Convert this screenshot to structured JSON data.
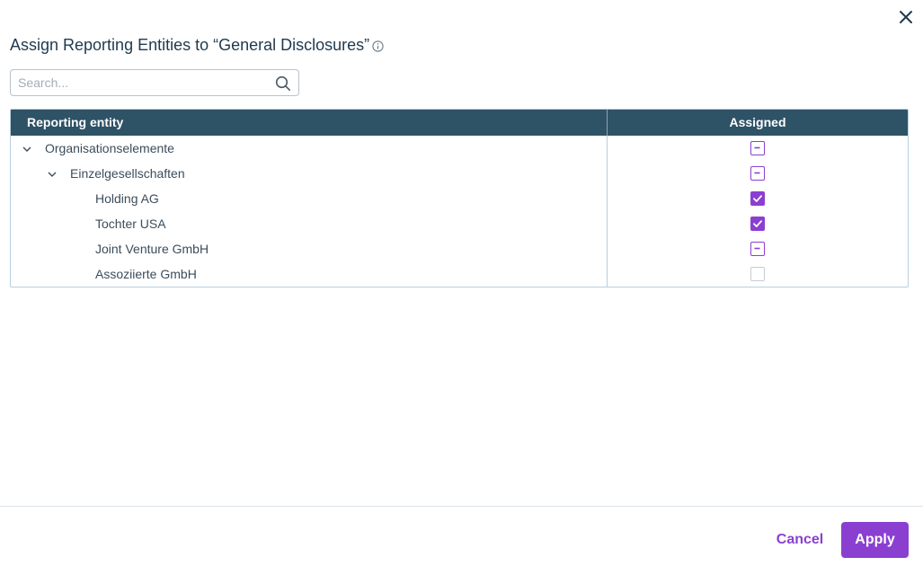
{
  "dialog": {
    "title": "Assign Reporting Entities to “General Disclosures”",
    "close_icon": "close-icon",
    "info_icon": "info-icon"
  },
  "search": {
    "placeholder": "Search...",
    "value": "",
    "icon": "search-icon"
  },
  "table": {
    "columns": {
      "entity": "Reporting entity",
      "assigned": "Assigned"
    },
    "rows": [
      {
        "label": "Organisationselemente",
        "level": 0,
        "expanded": true,
        "state": "partial"
      },
      {
        "label": "Einzelgesellschaften",
        "level": 1,
        "expanded": true,
        "state": "partial"
      },
      {
        "label": "Holding AG",
        "level": 2,
        "state": "checked"
      },
      {
        "label": "Tochter USA",
        "level": 2,
        "state": "checked"
      },
      {
        "label": "Joint Venture GmbH",
        "level": 2,
        "state": "partial"
      },
      {
        "label": "Assoziierte GmbH",
        "level": 2,
        "state": "unchecked"
      }
    ]
  },
  "footer": {
    "cancel_label": "Cancel",
    "apply_label": "Apply"
  },
  "colors": {
    "accent": "#8b3fd1",
    "header_bg": "#2e5266",
    "title_text": "#1e3a4f"
  }
}
